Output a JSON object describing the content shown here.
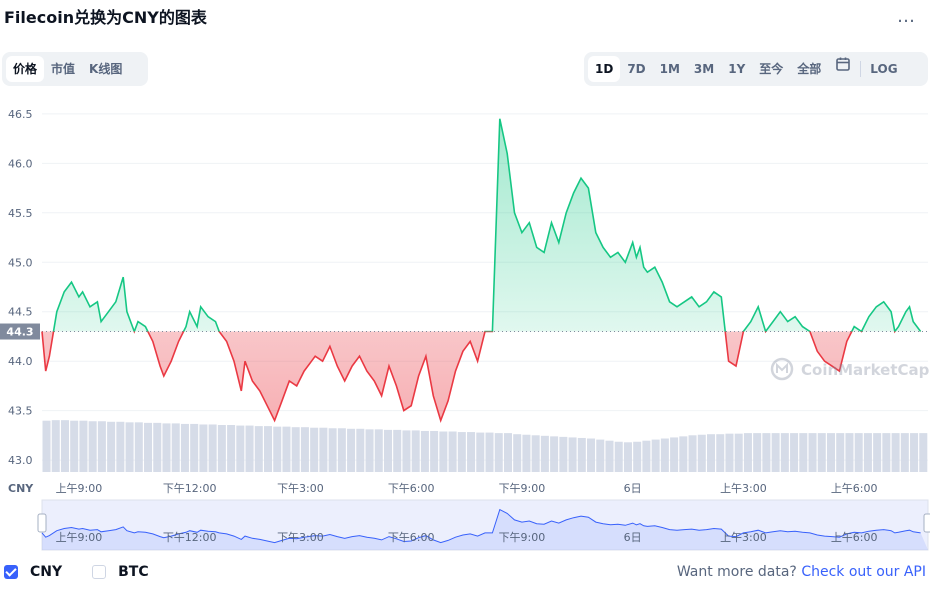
{
  "title": "Filecoin兑换为CNY的图表",
  "more_icon": "…",
  "metric_tabs": [
    "价格",
    "市值",
    "K线图"
  ],
  "range_tabs": [
    "1D",
    "7D",
    "1M",
    "3M",
    "1Y",
    "至今",
    "全部"
  ],
  "log_label": "LOG",
  "icons": {
    "calendar": "calendar-icon",
    "more": "more-icon",
    "watermark": "coinmarketcap-logo"
  },
  "watermark": "CoinMarketCap",
  "legend": {
    "cny": "CNY",
    "btc": "BTC"
  },
  "footer": {
    "text": "Want more data?",
    "link": "Check out our API"
  },
  "colors": {
    "up": "#16c784",
    "down": "#ea3943",
    "accent": "#3861fb",
    "grid": "#eff2f5"
  },
  "chart_data": {
    "type": "line",
    "currency_label": "CNY",
    "current_price_label": "44.3",
    "baseline": 44.3,
    "ylim": [
      42.9,
      46.6
    ],
    "yticks": [
      43.0,
      43.5,
      44.0,
      44.5,
      45.0,
      45.5,
      46.0,
      46.5
    ],
    "xlabels": [
      "上午9:00",
      "下午12:00",
      "下午3:00",
      "下午6:00",
      "下午9:00",
      "6日",
      "上午3:00",
      "上午6:00"
    ],
    "xlabel_positions": [
      1,
      4,
      7,
      10,
      13,
      16,
      19,
      22
    ],
    "x_hours": [
      0,
      0.1,
      0.2,
      0.4,
      0.6,
      0.8,
      1.0,
      1.1,
      1.3,
      1.5,
      1.6,
      1.8,
      2.0,
      2.2,
      2.3,
      2.5,
      2.6,
      2.8,
      3.0,
      3.2,
      3.3,
      3.5,
      3.7,
      3.9,
      4.0,
      4.2,
      4.3,
      4.5,
      4.7,
      4.8,
      5.0,
      5.2,
      5.4,
      5.5,
      5.7,
      5.9,
      6.1,
      6.3,
      6.5,
      6.7,
      6.9,
      7.1,
      7.3,
      7.4,
      7.6,
      7.8,
      8.0,
      8.2,
      8.4,
      8.6,
      8.8,
      9.0,
      9.2,
      9.4,
      9.6,
      9.8,
      10.0,
      10.2,
      10.4,
      10.6,
      10.8,
      11.0,
      11.2,
      11.4,
      11.6,
      11.8,
      12.0,
      12.2,
      12.4,
      12.6,
      12.8,
      13.0,
      13.2,
      13.4,
      13.6,
      13.8,
      14.0,
      14.2,
      14.4,
      14.6,
      14.8,
      15.0,
      15.2,
      15.4,
      15.6,
      15.8,
      16.0,
      16.1,
      16.2,
      16.3,
      16.4,
      16.6,
      16.8,
      17.0,
      17.2,
      17.4,
      17.6,
      17.8,
      18.0,
      18.2,
      18.4,
      18.6,
      18.8,
      19.0,
      19.2,
      19.4,
      19.6,
      19.8,
      20.0,
      20.2,
      20.4,
      20.6,
      20.8,
      21.0,
      21.2,
      21.4,
      21.6,
      21.8,
      22.0,
      22.2,
      22.4,
      22.6,
      22.8,
      23.0,
      23.1,
      23.2,
      23.4,
      23.5,
      23.6,
      23.8
    ],
    "values": [
      44.3,
      43.9,
      44.05,
      44.5,
      44.7,
      44.8,
      44.65,
      44.7,
      44.55,
      44.6,
      44.4,
      44.5,
      44.6,
      44.85,
      44.5,
      44.3,
      44.4,
      44.35,
      44.2,
      43.95,
      43.85,
      44.0,
      44.2,
      44.35,
      44.5,
      44.35,
      44.55,
      44.45,
      44.4,
      44.3,
      44.2,
      44.0,
      43.7,
      44.0,
      43.8,
      43.7,
      43.55,
      43.4,
      43.6,
      43.8,
      43.75,
      43.9,
      44.0,
      44.05,
      44.0,
      44.15,
      43.95,
      43.8,
      43.95,
      44.05,
      43.9,
      43.8,
      43.65,
      43.95,
      43.75,
      43.5,
      43.55,
      43.85,
      44.05,
      43.65,
      43.4,
      43.6,
      43.9,
      44.1,
      44.2,
      44.0,
      44.3,
      44.3,
      46.45,
      46.1,
      45.5,
      45.3,
      45.4,
      45.15,
      45.1,
      45.4,
      45.2,
      45.5,
      45.7,
      45.85,
      45.75,
      45.3,
      45.15,
      45.05,
      45.1,
      45.0,
      45.2,
      45.05,
      45.15,
      44.95,
      44.9,
      44.95,
      44.8,
      44.6,
      44.55,
      44.6,
      44.65,
      44.55,
      44.6,
      44.7,
      44.65,
      44.0,
      43.95,
      44.3,
      44.4,
      44.55,
      44.3,
      44.4,
      44.5,
      44.4,
      44.45,
      44.35,
      44.3,
      44.1,
      44.0,
      43.95,
      43.9,
      44.2,
      44.35,
      44.3,
      44.45,
      44.55,
      44.6,
      44.5,
      44.3,
      44.35,
      44.5,
      44.55,
      44.4,
      44.3
    ],
    "volume_relative": [
      0.95,
      0.96,
      0.96,
      0.95,
      0.95,
      0.94,
      0.94,
      0.93,
      0.93,
      0.92,
      0.92,
      0.91,
      0.91,
      0.9,
      0.9,
      0.89,
      0.89,
      0.88,
      0.88,
      0.87,
      0.87,
      0.86,
      0.86,
      0.85,
      0.85,
      0.84,
      0.84,
      0.83,
      0.83,
      0.82,
      0.82,
      0.81,
      0.81,
      0.8,
      0.8,
      0.79,
      0.79,
      0.78,
      0.78,
      0.77,
      0.77,
      0.76,
      0.76,
      0.75,
      0.75,
      0.74,
      0.74,
      0.73,
      0.73,
      0.72,
      0.72,
      0.7,
      0.69,
      0.68,
      0.67,
      0.66,
      0.65,
      0.64,
      0.63,
      0.62,
      0.6,
      0.58,
      0.56,
      0.55,
      0.56,
      0.58,
      0.6,
      0.62,
      0.64,
      0.66,
      0.68,
      0.69,
      0.7,
      0.7,
      0.71,
      0.71,
      0.72,
      0.72,
      0.72,
      0.72,
      0.72,
      0.72,
      0.72,
      0.72,
      0.72,
      0.72,
      0.72,
      0.72,
      0.72,
      0.72,
      0.72,
      0.72,
      0.72,
      0.72,
      0.72,
      0.72
    ]
  }
}
